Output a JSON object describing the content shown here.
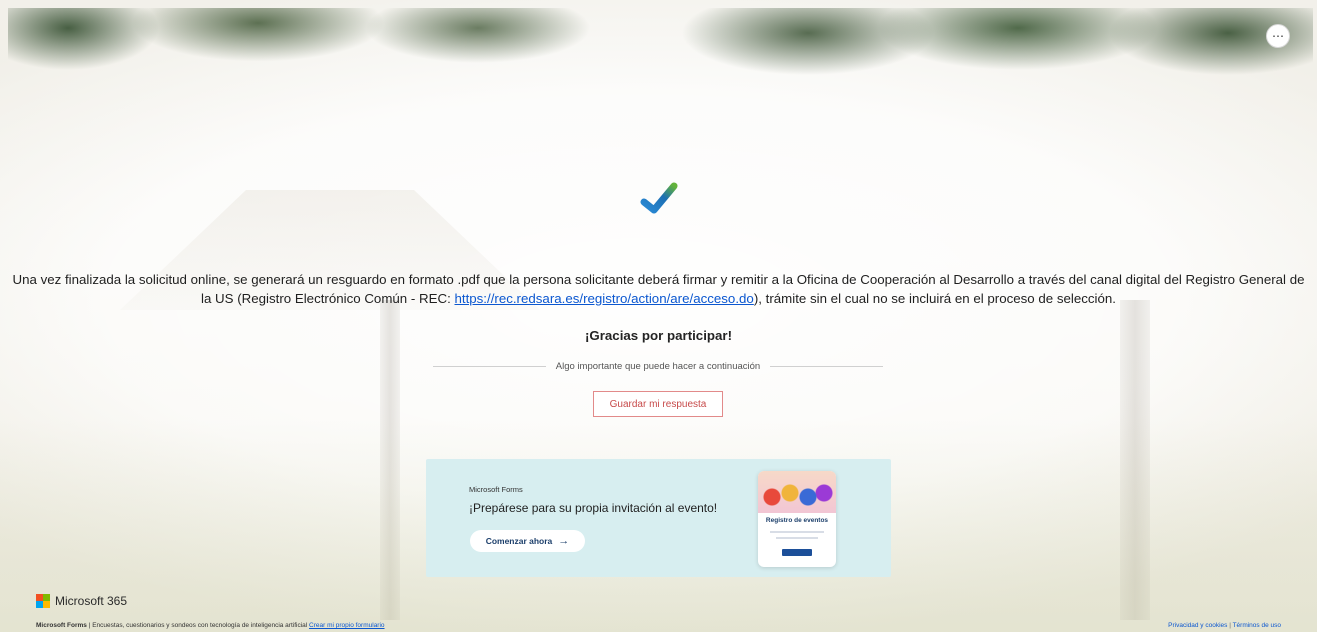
{
  "header": {
    "more_options_icon": "ellipsis-icon",
    "more_options_label": "⋯"
  },
  "confirmation": {
    "check_icon": "checkmark-icon",
    "message_before_link": "Una vez finalizada la solicitud online, se generará un resguardo en formato .pdf que la persona solicitante deberá firmar y remitir a la Oficina de Cooperación al Desarrollo a través del canal digital del Registro General de la US (Registro Electrónico Común - REC: ",
    "link_text": "https://rec.redsara.es/registro/action/are/acceso.do",
    "message_after_link": "), trámite sin el cual no se incluirá en el proceso de selección.",
    "thanks": "¡Gracias por participar!",
    "next_step_label": "Algo importante que puede hacer a continuación",
    "save_button": "Guardar mi respuesta"
  },
  "promo": {
    "brand": "Microsoft Forms",
    "title": "¡Prepárese para su propia invitación al evento!",
    "cta_label": "Comenzar ahora",
    "cta_icon": "arrow-right-icon",
    "card_title": "Registro de eventos"
  },
  "footer": {
    "brand": "Microsoft 365",
    "forms_name": "Microsoft Forms",
    "forms_tagline": " | Encuestas, cuestionarios y sondeos con tecnología de inteligencia artificial ",
    "create_link": "Crear mi propio formulario",
    "privacy_link": "Privacidad y cookies",
    "separator": " | ",
    "terms_link": "Términos de uso"
  },
  "colors": {
    "accent_red": "#c74a4a",
    "link_blue": "#0b57d0",
    "promo_bg": "#d7eef0",
    "ms_logo": [
      "#f25022",
      "#7fba00",
      "#00a4ef",
      "#ffb900"
    ]
  }
}
